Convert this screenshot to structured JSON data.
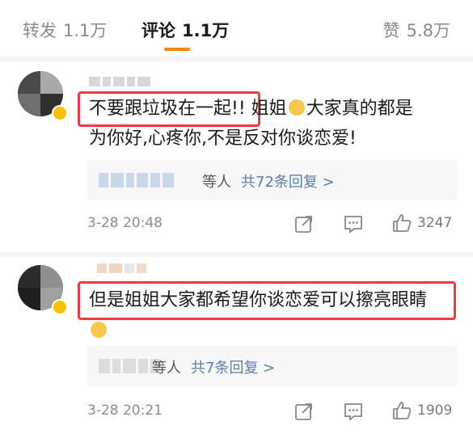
{
  "tabs": {
    "repost": {
      "label": "转发",
      "count": "1.1万"
    },
    "comment": {
      "label": "评论",
      "count": "1.1万"
    },
    "like": {
      "label": "赞",
      "count": "5.8万"
    }
  },
  "comments": [
    {
      "text_highlight": "不要跟垃圾在一起!",
      "text_rest_1": "! 姐姐",
      "text_rest_2": "大家真的都是",
      "text_line2": "为你好,心疼你,不是反对你谈恋爱!",
      "reply_suffix": "等人",
      "reply_link": "共72条回复 >",
      "time": "3-28 20:48",
      "likes": "3247"
    },
    {
      "text_highlight": "但是姐姐大家都希望你谈恋爱可以擦亮眼睛",
      "reply_suffix": "等人",
      "reply_link": "共7条回复 >",
      "time": "3-28 20:21",
      "likes": "1909"
    }
  ],
  "icons": {
    "share": "share-icon",
    "comment": "comment-icon",
    "like": "thumbs-up-icon"
  },
  "colors": {
    "accent": "#ff8200",
    "highlight": "#ee3a43",
    "link": "#5a7fad"
  }
}
